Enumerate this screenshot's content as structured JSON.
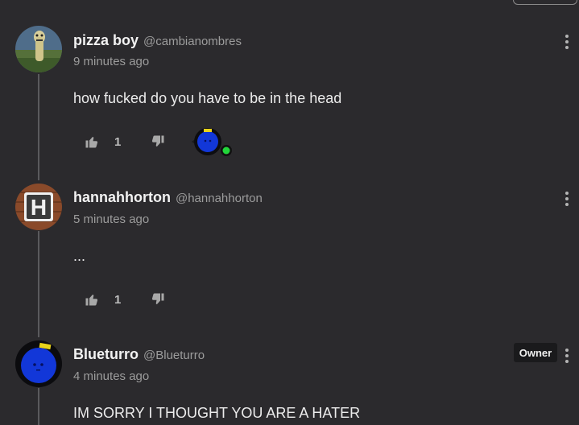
{
  "comments": [
    {
      "author": "pizza boy",
      "handle": "@cambianombres",
      "time": "9 minutes ago",
      "text": "how fucked do you have to be in the head",
      "likes": "1"
    },
    {
      "author": "hannahhorton",
      "handle": "@hannahhorton",
      "time": "5 minutes ago",
      "text": "...",
      "likes": "1"
    },
    {
      "author": "Blueturro",
      "handle": "@Blueturro",
      "time": "4 minutes ago",
      "text": "IM SORRY I THOUGHT YOU ARE A HATER",
      "badge": "Owner"
    }
  ],
  "avatar_letter": "H",
  "colors": {
    "background": "#2b2a2d",
    "owner_avatar_blue": "#1237d8",
    "online_dot": "#22d63a",
    "h_avatar_brown": "#8a4a2a"
  },
  "icons": [
    "thumbs-up-icon",
    "thumbs-down-icon",
    "more-vertical-icon"
  ]
}
